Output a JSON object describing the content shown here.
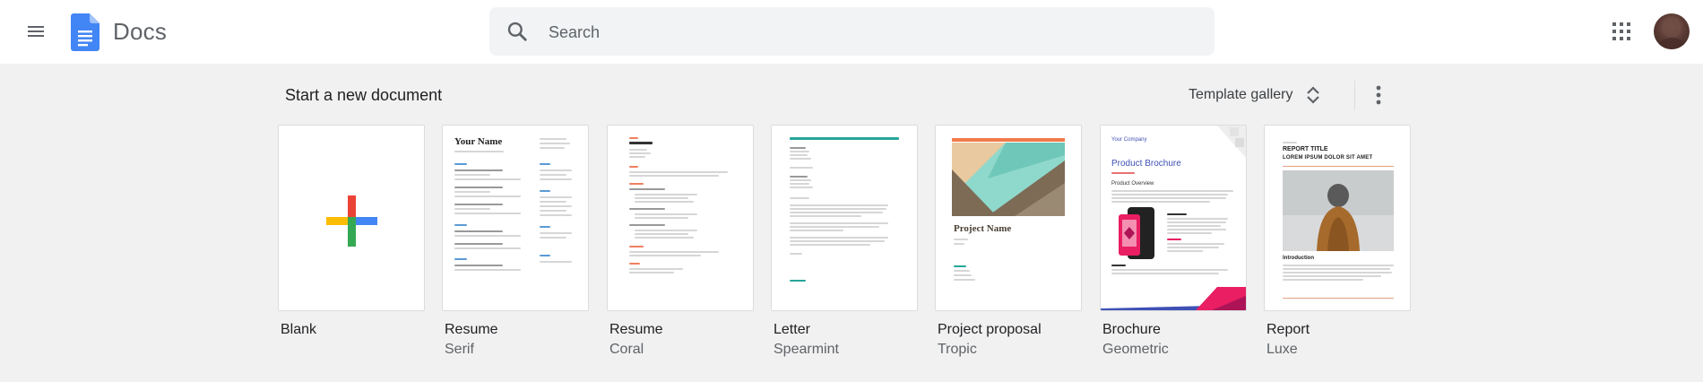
{
  "header": {
    "app_name": "Docs",
    "search": {
      "placeholder": "Search",
      "value": ""
    }
  },
  "section": {
    "title": "Start a new document",
    "gallery_label": "Template gallery"
  },
  "templates": [
    {
      "name": "Blank",
      "subtitle": ""
    },
    {
      "name": "Resume",
      "subtitle": "Serif",
      "preview_heading": "Your Name"
    },
    {
      "name": "Resume",
      "subtitle": "Coral"
    },
    {
      "name": "Letter",
      "subtitle": "Spearmint"
    },
    {
      "name": "Project proposal",
      "subtitle": "Tropic",
      "preview_heading": "Project Name"
    },
    {
      "name": "Brochure",
      "subtitle": "Geometric",
      "preview_company": "Your Company",
      "preview_heading": "Product Brochure",
      "preview_section": "Product Overview"
    },
    {
      "name": "Report",
      "subtitle": "Luxe",
      "preview_heading": "REPORT TITLE",
      "preview_subheading": "LOREM IPSUM DOLOR SIT AMET",
      "preview_section": "Introduction"
    }
  ],
  "colors": {
    "docs_blue": "#4285f4",
    "google_red": "#ea4335",
    "google_yellow": "#fbbc04",
    "google_green": "#34a853",
    "tropic_teal": "#8fd8cc",
    "tropic_brown": "#7d6b55",
    "tropic_orange": "#f07b4a",
    "brochure_purple": "#3f51b5",
    "brochure_pink": "#e91e63"
  },
  "icons": [
    "menu-icon",
    "docs-logo-icon",
    "search-icon",
    "apps-grid-icon",
    "unfold-more-icon",
    "more-vert-icon",
    "plus-icon"
  ]
}
